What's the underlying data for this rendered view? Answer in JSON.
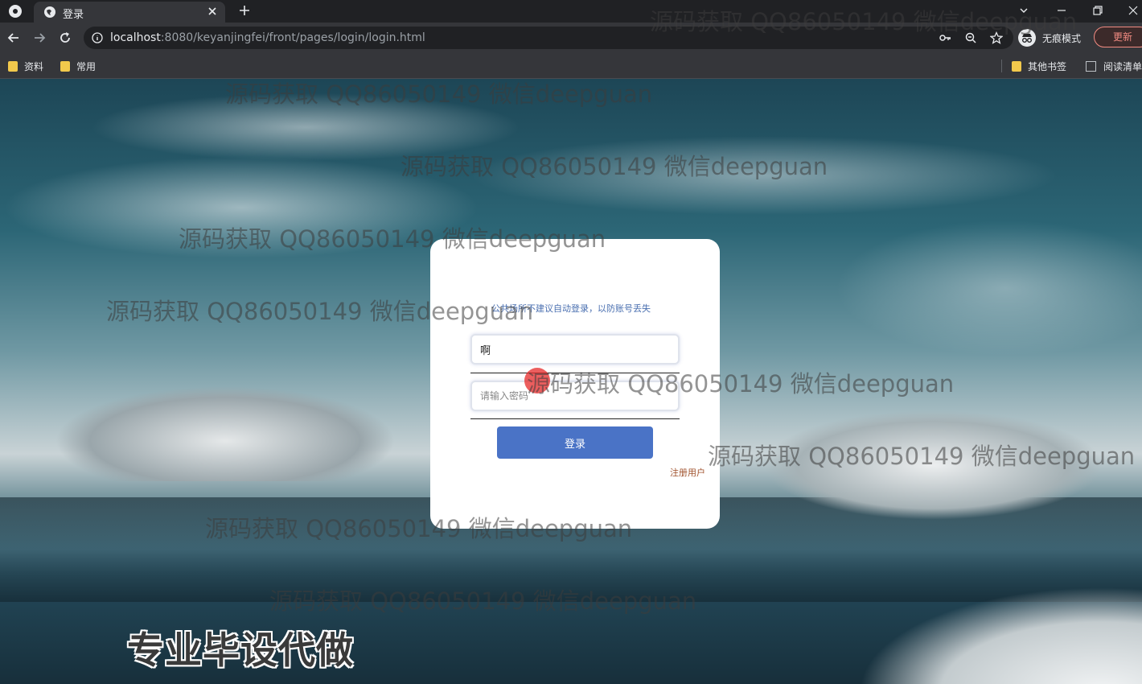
{
  "browser": {
    "tab_title": "登录",
    "url_host": "localhost",
    "url_path": ":8080/keyanjingfei/front/pages/login/login.html",
    "profile_label": "无痕模式",
    "update_label": "更新",
    "bookmarks": [
      "资料",
      "常用"
    ],
    "bookmarks_right": [
      "其他书签",
      "阅读清单"
    ]
  },
  "login": {
    "notice": "公共场所不建议自动登录，以防账号丢失",
    "username_value": "啊",
    "password_placeholder": "请输入密码",
    "login_button": "登录",
    "register_link": "注册用户"
  },
  "watermark": {
    "text": "源码获取 QQ86050149 微信deepguan",
    "banner": "专业毕设代做"
  },
  "colors": {
    "accent": "#4a73c6",
    "register_link": "#a0522d",
    "notice": "#4a6fb0"
  }
}
